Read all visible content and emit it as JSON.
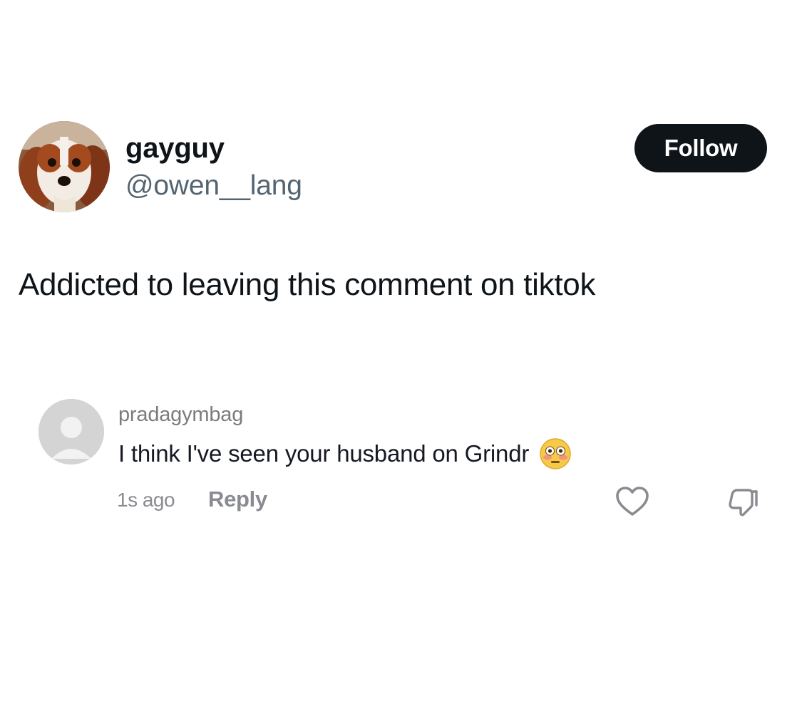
{
  "tweet": {
    "author": {
      "display_name": "gayguy",
      "handle": "@owen__lang",
      "avatar_icon": "cavalier-spaniel-avatar"
    },
    "follow_label": "Follow",
    "text": "Addicted to leaving this comment on tiktok"
  },
  "comment": {
    "username": "pradagymbag",
    "text": "I think I've seen your husband on Grindr",
    "emoji": "flushed-face",
    "time": "1s ago",
    "reply_label": "Reply",
    "icons": {
      "like": "heart-outline-icon",
      "dislike": "thumbs-down-icon"
    }
  },
  "colors": {
    "text_primary": "#0f1419",
    "text_secondary": "#536471",
    "button_bg": "#0f1419",
    "comment_meta": "#8a8b91"
  }
}
